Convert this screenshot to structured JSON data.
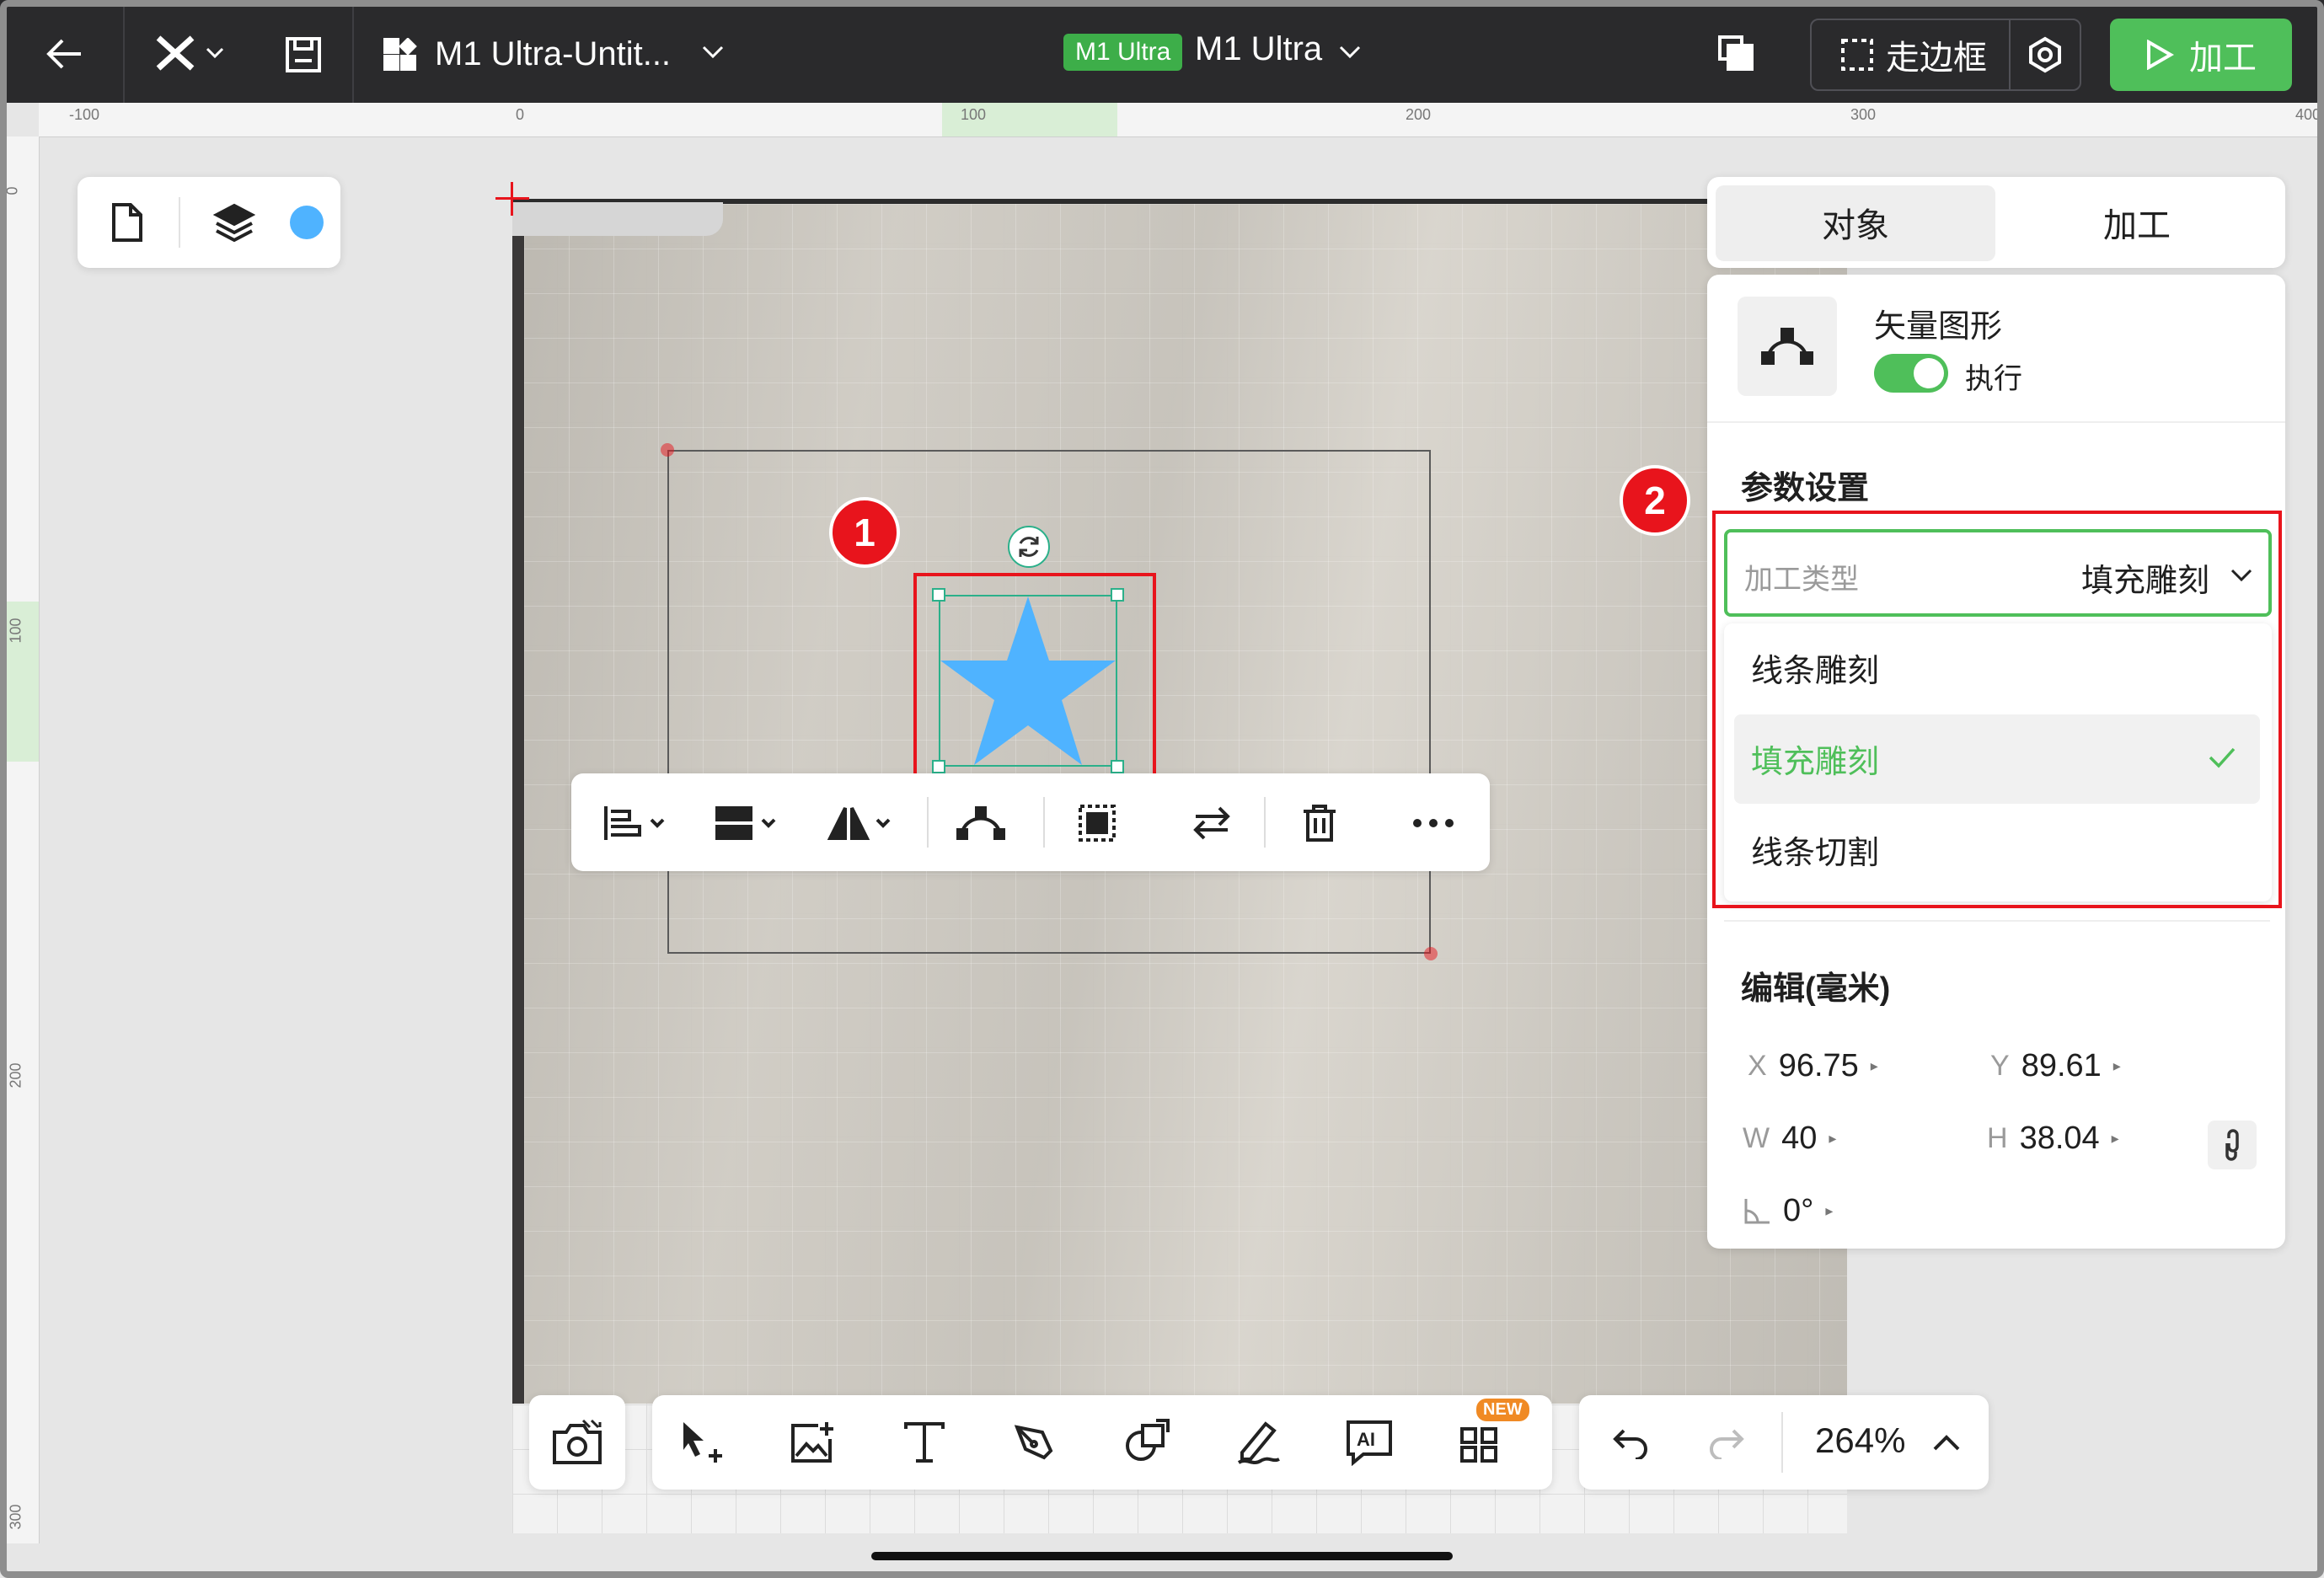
{
  "topbar": {
    "file_title": "M1 Ultra-Untit...",
    "device_badge": "M1 Ultra",
    "device_name": "M1 Ultra",
    "frame_button": "走边框",
    "process_button": "加工",
    "icons": [
      "back-arrow-icon",
      "xtool-logo-icon",
      "chevron-down-icon",
      "save-icon",
      "apps-icon",
      "copy-icon",
      "dashed-frame-icon",
      "settings-icon",
      "play-icon"
    ]
  },
  "rulers": {
    "top_labels": [
      "-100",
      "0",
      "100",
      "200",
      "300",
      "400"
    ],
    "left_labels": [
      "0",
      "100",
      "200",
      "300"
    ]
  },
  "left_panel": {
    "icons": [
      "document-icon",
      "layers-icon",
      "color-dot-icon"
    ],
    "dot_color": "#4fb3ff"
  },
  "annotations": {
    "badge1": "1",
    "badge2": "2"
  },
  "object_toolbar": {
    "icons": [
      "align-icon",
      "distribute-icon",
      "flip-icon",
      "edit-nodes-icon",
      "group-icon",
      "swap-icon",
      "delete-icon",
      "more-icon"
    ]
  },
  "right_panel": {
    "tabs": [
      "对象",
      "加工"
    ],
    "object_type": "矢量图形",
    "toggle_label": "执行",
    "params_title": "参数设置",
    "process_type_label": "加工类型",
    "process_type_value": "填充雕刻",
    "options": [
      "线条雕刻",
      "填充雕刻",
      "线条切割"
    ],
    "selected_option": "填充雕刻",
    "edit_title": "编辑(毫米)",
    "x_key": "X",
    "x_val": "96.75",
    "y_key": "Y",
    "y_val": "89.61",
    "w_key": "W",
    "w_val": "40",
    "h_key": "H",
    "h_val": "38.04",
    "angle_val": "0°",
    "accent": "#4fbf5a"
  },
  "bottom_toolbar": {
    "icons": [
      "camera-icon",
      "select-add-icon",
      "image-add-icon",
      "text-icon",
      "pen-icon",
      "shapes-icon",
      "draw-icon",
      "ai-text-icon",
      "apps-new-icon"
    ],
    "new_badge": "NEW"
  },
  "zoom": {
    "value": "264%",
    "icons": [
      "undo-icon",
      "redo-icon",
      "chevron-up-icon"
    ]
  },
  "star": {
    "color": "#4fb3ff"
  }
}
